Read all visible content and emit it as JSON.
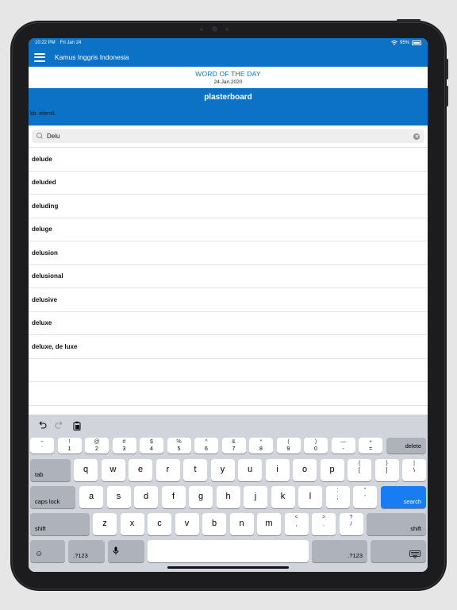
{
  "status_bar": {
    "time": "10:22 PM",
    "date": "Fri Jan 24",
    "battery": "95%"
  },
  "app": {
    "title": "Kamus Inggris Indonesia"
  },
  "word_of_the_day": {
    "label": "WORD OF THE DAY",
    "date": "24.Jan.2020",
    "word": "plasterboard",
    "definition": "kb. eternit."
  },
  "search": {
    "value": "Delu"
  },
  "results": [
    "delude",
    "deluded",
    "deluding",
    "deluge",
    "delusion",
    "delusional",
    "delusive",
    "deluxe",
    "deluxe, de luxe"
  ],
  "keyboard": {
    "toolbar": [
      "undo-icon",
      "redo-icon",
      "paste-icon"
    ],
    "number_row": [
      {
        "top": "~",
        "bottom": "`"
      },
      {
        "top": "!",
        "bottom": "1"
      },
      {
        "top": "@",
        "bottom": "2"
      },
      {
        "top": "$",
        "bottom": "4"
      },
      {
        "top": "%",
        "bottom": "5"
      },
      {
        "top": "^",
        "bottom": "6"
      },
      {
        "top": "&",
        "bottom": "7"
      },
      {
        "top": "*",
        "bottom": "8"
      },
      {
        "top": "(",
        "bottom": "9"
      },
      {
        "top": ")",
        "bottom": "0"
      },
      {
        "top": "—",
        "bottom": "-"
      },
      {
        "top": "+",
        "bottom": "="
      }
    ],
    "number_row_extra": {
      "top": "#",
      "bottom": "3"
    },
    "delete": "delete",
    "tab": "tab",
    "row_q": [
      "q",
      "w",
      "e",
      "r",
      "t",
      "y",
      "u",
      "i",
      "o",
      "p"
    ],
    "row_q_symbols": [
      {
        "top": "{",
        "bottom": "["
      },
      {
        "top": "}",
        "bottom": "]"
      },
      {
        "top": "|",
        "bottom": "\\"
      }
    ],
    "caps_lock": "caps lock",
    "row_a": [
      "a",
      "s",
      "d",
      "f",
      "g",
      "h",
      "j",
      "k",
      "l"
    ],
    "row_a_symbols": [
      {
        "top": ":",
        "bottom": ";"
      },
      {
        "top": "\"",
        "bottom": "'"
      }
    ],
    "search_key": "search",
    "shift": "shift",
    "row_z": [
      "z",
      "x",
      "c",
      "v",
      "b",
      "n",
      "m"
    ],
    "row_z_symbols": [
      {
        "top": "<",
        "bottom": ","
      },
      {
        "top": ">",
        "bottom": "."
      },
      {
        "top": "?",
        "bottom": "/"
      }
    ],
    "emoji": "☺",
    "numbers": ".?123",
    "mic": "mic-icon",
    "hide": "keyboard-hide-icon"
  }
}
